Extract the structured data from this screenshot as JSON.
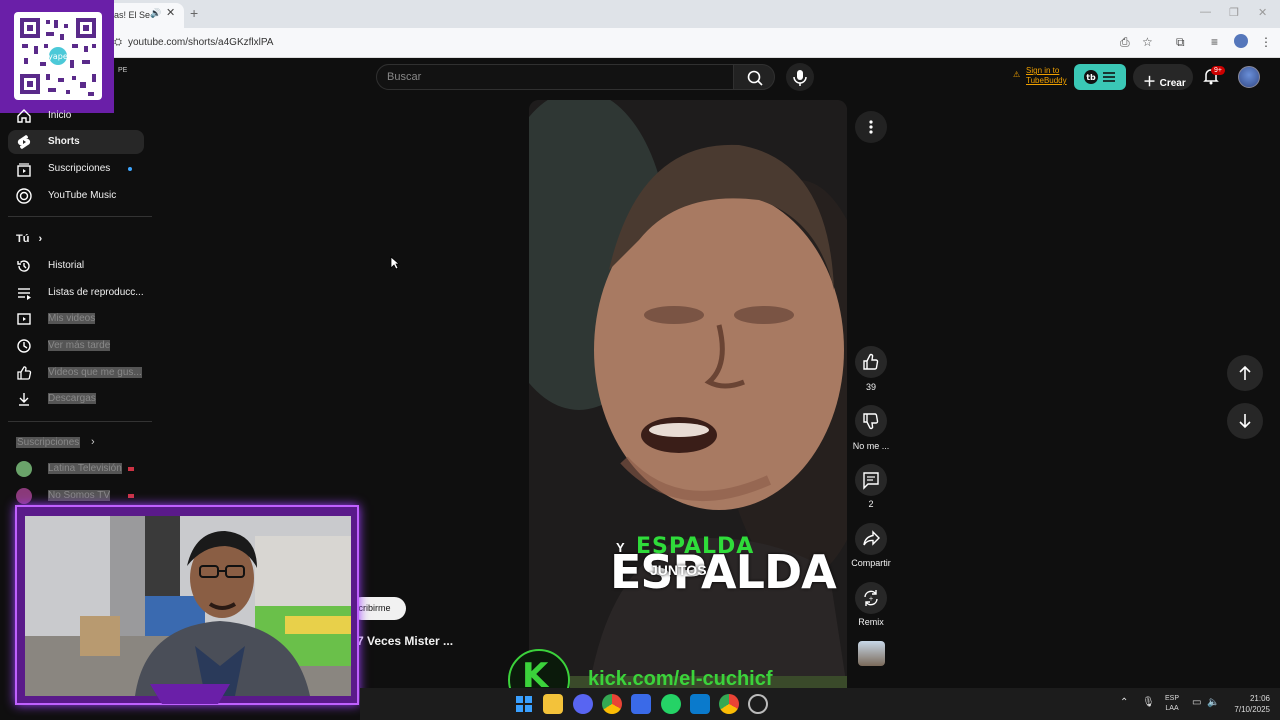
{
  "browser": {
    "tab_title": "as! El Se",
    "url": "youtube.com/shorts/a4GKzflxlPA"
  },
  "header": {
    "search_placeholder": "Buscar",
    "tubebuddy_line1": "Sign in to",
    "tubebuddy_line2": "TubeBuddy",
    "create_label": "Crear",
    "notif_count": "9+",
    "country_code": "PE"
  },
  "sidebar": {
    "items": [
      {
        "label": "Inicio",
        "icon": "home-icon"
      },
      {
        "label": "Shorts",
        "icon": "shorts-icon"
      },
      {
        "label": "Suscripciones",
        "icon": "subscriptions-icon"
      },
      {
        "label": "YouTube Music",
        "icon": "music-icon"
      }
    ],
    "you_label": "Tú",
    "you_items": [
      {
        "label": "Historial",
        "icon": "history-icon"
      },
      {
        "label": "Listas de reproducc...",
        "icon": "playlist-icon"
      },
      {
        "label": "Mis videos",
        "icon": "my-videos-icon"
      },
      {
        "label": "Ver más tarde",
        "icon": "clock-icon"
      },
      {
        "label": "Videos que me gus...",
        "icon": "like-icon"
      },
      {
        "label": "Descargas",
        "icon": "download-icon"
      }
    ],
    "subs_label": "Suscripciones",
    "subs": [
      {
        "label": "Latina Televisión"
      },
      {
        "label": "No Somos TV"
      }
    ]
  },
  "short": {
    "caption_green": "ESPALDA",
    "caption_big": "ESPALDA",
    "caption_y": "Y",
    "caption_juntos": "JUNTOS",
    "like_count": "39",
    "dislike_label": "No me ...",
    "comment_count": "2",
    "share_label": "Compartir",
    "remix_label": "Remix",
    "subscribe_label": "scribirme",
    "title": "7 Veces Mister ..."
  },
  "overlay": {
    "kick_letter": "K",
    "kick_url": "kick.com/el-cuchicf"
  },
  "taskbar": {
    "lang_line1": "ESP",
    "lang_line2": "LAA",
    "time": "21:06",
    "date": "7/10/2025"
  },
  "colors": {
    "background": "#0f0f0f",
    "tubebuddy": "#3ac8b6",
    "kick_green": "#3bd33b",
    "overlay_purple": "#6a1fa8"
  }
}
